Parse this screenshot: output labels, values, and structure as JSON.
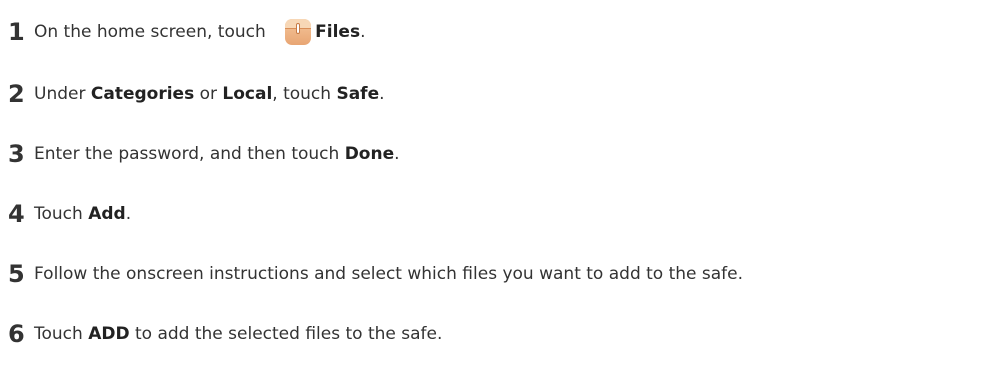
{
  "steps": [
    {
      "number": "1",
      "parts": [
        "On the home screen, touch ",
        "Files",
        "."
      ]
    },
    {
      "number": "2",
      "parts": [
        "Under ",
        "Categories",
        " or ",
        "Local",
        ", touch ",
        "Safe",
        "."
      ]
    },
    {
      "number": "3",
      "parts": [
        "Enter the password, and then touch ",
        "Done",
        "."
      ]
    },
    {
      "number": "4",
      "parts": [
        "Touch ",
        "Add",
        "."
      ]
    },
    {
      "number": "5",
      "parts": [
        "Follow the onscreen instructions and select which files you want to add to the safe."
      ]
    },
    {
      "number": "6",
      "parts": [
        "Touch ",
        "ADD",
        " to add the selected files to the safe."
      ]
    }
  ],
  "icons": {
    "files_app": "files-app-icon"
  },
  "colors": {
    "text": "#333333",
    "icon_bg": "#e8a573"
  }
}
